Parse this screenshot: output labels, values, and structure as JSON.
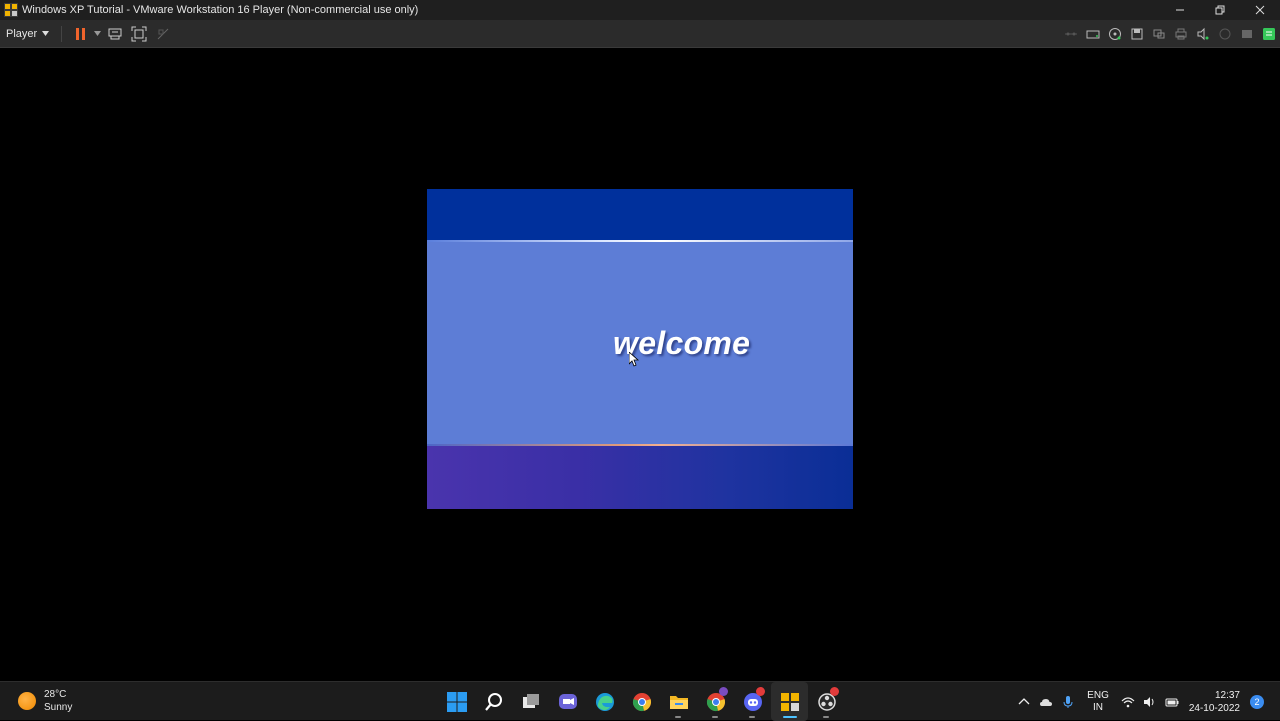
{
  "window": {
    "title": "Windows XP Tutorial - VMware Workstation 16 Player (Non-commercial use only)",
    "controls": [
      "minimize-icon",
      "restore-icon",
      "close-icon"
    ]
  },
  "toolbar": {
    "player_menu_label": "Player",
    "left_icons": [
      "pause-icon",
      "send-ctrl-alt-del-icon",
      "full-screen-icon",
      "unity-icon"
    ],
    "device_icons": [
      "network-adapter-icon",
      "hard-disk-icon",
      "cd-dvd-icon",
      "floppy-icon",
      "usb-icon",
      "printer-icon",
      "sound-card-icon",
      "display-icon",
      "removable-device-icon",
      "message-log-icon"
    ],
    "pause_color": "#f0642c",
    "accent_color": "#35c759"
  },
  "guest": {
    "welcome_text": "welcome",
    "colors": {
      "top_band": "#00309c",
      "middle": "#5d7dd6",
      "bottom_left": "#4a34ad",
      "bottom_right": "#0a2e96"
    }
  },
  "taskbar": {
    "weather": {
      "temperature": "28°C",
      "condition": "Sunny"
    },
    "apps": [
      {
        "name": "start-button",
        "icon": "windows-logo-icon"
      },
      {
        "name": "search-button",
        "icon": "search-icon"
      },
      {
        "name": "task-view-button",
        "icon": "task-view-icon"
      },
      {
        "name": "chat-button",
        "icon": "chat-icon"
      },
      {
        "name": "edge-button",
        "icon": "edge-icon"
      },
      {
        "name": "chrome-button",
        "icon": "chrome-icon"
      },
      {
        "name": "file-explorer-button",
        "icon": "folder-icon"
      },
      {
        "name": "chrome-profile-button",
        "icon": "chrome-profile-icon"
      },
      {
        "name": "discord-button",
        "icon": "discord-icon"
      },
      {
        "name": "vmware-button",
        "icon": "vmware-icon"
      },
      {
        "name": "obs-button",
        "icon": "obs-icon"
      }
    ],
    "tray": {
      "language_line1": "ENG",
      "language_line2": "IN",
      "time": "12:37",
      "date": "24-10-2022",
      "notification_count": "2"
    }
  }
}
